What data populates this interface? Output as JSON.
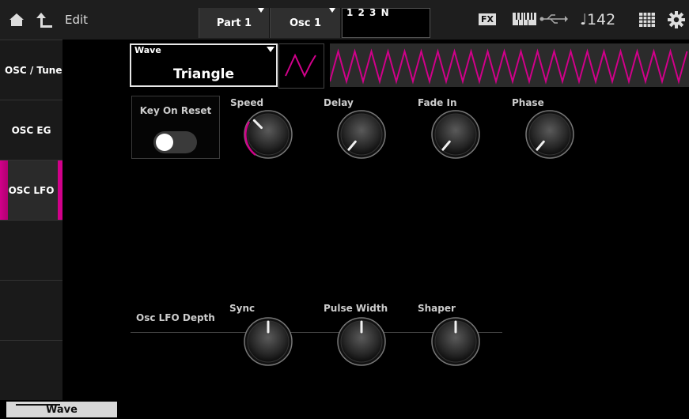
{
  "header": {
    "edit_label": "Edit",
    "part_label": "Part 1",
    "osc_label": "Osc 1",
    "name_text": "1 2 3 N",
    "fx_label": "FX",
    "tempo": "♩142"
  },
  "sidebar": {
    "items": [
      {
        "label": "OSC / Tune"
      },
      {
        "label": "OSC EG"
      },
      {
        "label": "OSC LFO"
      },
      {
        "label": ""
      },
      {
        "label": ""
      },
      {
        "label": ""
      }
    ],
    "active_index": 2
  },
  "wave": {
    "label": "Wave",
    "value": "Triangle"
  },
  "key_on_reset": {
    "label": "Key On Reset",
    "on": false
  },
  "knobs": {
    "speed": {
      "label": "Speed"
    },
    "delay": {
      "label": "Delay"
    },
    "fade_in": {
      "label": "Fade In"
    },
    "phase": {
      "label": "Phase"
    }
  },
  "depth": {
    "label": "Osc LFO Depth",
    "sync": {
      "label": "Sync"
    },
    "pulse_width": {
      "label": "Pulse Width"
    },
    "shaper": {
      "label": "Shaper"
    }
  },
  "bottom_tab": {
    "label": "Wave"
  },
  "colors": {
    "accent": "#d1008a",
    "background": "#000000"
  }
}
